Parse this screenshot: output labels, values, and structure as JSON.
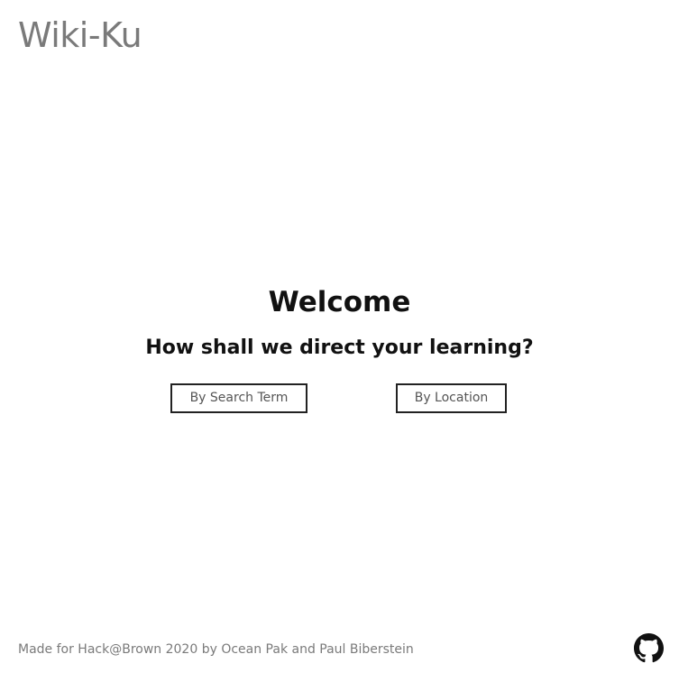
{
  "header": {
    "title": "Wiki-Ku"
  },
  "main": {
    "welcome": "Welcome",
    "prompt": "How shall we direct your learning?",
    "buttons": {
      "search_label": "By Search Term",
      "location_label": "By Location"
    }
  },
  "footer": {
    "credit": "Made for Hack@Brown 2020 by Ocean Pak and Paul Biberstein",
    "github_icon": "github-icon"
  }
}
